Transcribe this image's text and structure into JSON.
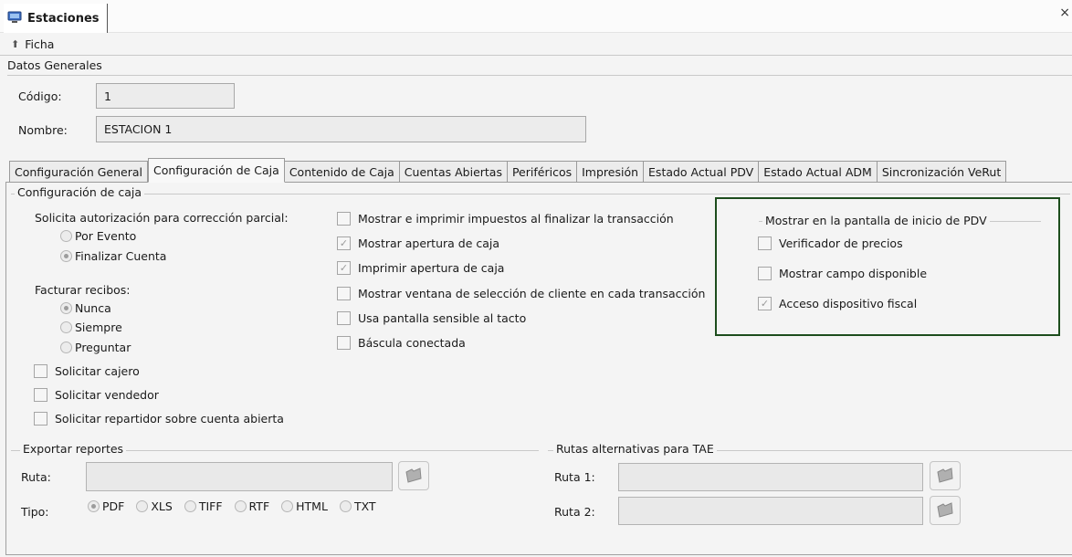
{
  "window": {
    "tab_title": "Estaciones",
    "close_glyph": "×",
    "icon": "monitor-icon"
  },
  "ficha": {
    "label": "Ficha",
    "icon": "double-chevron-up-icon"
  },
  "datos_generales": {
    "title": "Datos Generales",
    "codigo_label": "Código:",
    "codigo_value": "1",
    "nombre_label": "Nombre:",
    "nombre_value": "ESTACION 1"
  },
  "tabs": [
    {
      "label": "Configuración General",
      "active": false
    },
    {
      "label": "Configuración de Caja",
      "active": true
    },
    {
      "label": "Contenido de Caja",
      "active": false
    },
    {
      "label": "Cuentas Abiertas",
      "active": false
    },
    {
      "label": "Periféricos",
      "active": false
    },
    {
      "label": "Impresión",
      "active": false
    },
    {
      "label": "Estado Actual PDV",
      "active": false
    },
    {
      "label": "Estado Actual ADM",
      "active": false
    },
    {
      "label": "Sincronización VeRut",
      "active": false
    }
  ],
  "config_caja": {
    "title": "Configuración de caja",
    "autorizacion_label": "Solicita autorización para corrección parcial:",
    "autorizacion_options": [
      {
        "label": "Por Evento",
        "checked": false
      },
      {
        "label": "Finalizar Cuenta",
        "checked": true
      }
    ],
    "facturar_label": "Facturar recibos:",
    "facturar_options": [
      {
        "label": "Nunca",
        "checked": true
      },
      {
        "label": "Siempre",
        "checked": false
      },
      {
        "label": "Preguntar",
        "checked": false
      }
    ],
    "checks_left": [
      {
        "label": "Solicitar cajero",
        "checked": false
      },
      {
        "label": "Solicitar vendedor",
        "checked": false
      },
      {
        "label": "Solicitar repartidor sobre cuenta abierta",
        "checked": false
      }
    ],
    "checks_middle": [
      {
        "label": "Mostrar e imprimir impuestos al finalizar la transacción",
        "checked": false
      },
      {
        "label": "Mostrar apertura de caja",
        "checked": true
      },
      {
        "label": "Imprimir apertura de caja",
        "checked": true
      },
      {
        "label": "Mostrar ventana de selección de cliente en cada transacción",
        "checked": false
      },
      {
        "label": "Usa pantalla sensible al tacto",
        "checked": false
      },
      {
        "label": "Báscula conectada",
        "checked": false
      }
    ],
    "pdv_group": {
      "title": "Mostrar en la pantalla de inicio de PDV",
      "checks": [
        {
          "label": "Verificador de precios",
          "checked": false
        },
        {
          "label": "Mostrar campo disponible",
          "checked": false
        },
        {
          "label": "Acceso dispositivo fiscal",
          "checked": true
        }
      ]
    }
  },
  "exportar": {
    "title": "Exportar reportes",
    "ruta_label": "Ruta:",
    "ruta_value": "",
    "tipo_label": "Tipo:",
    "tipo_options": [
      {
        "label": "PDF",
        "checked": true
      },
      {
        "label": "XLS",
        "checked": false
      },
      {
        "label": "TIFF",
        "checked": false
      },
      {
        "label": "RTF",
        "checked": false
      },
      {
        "label": "HTML",
        "checked": false
      },
      {
        "label": "TXT",
        "checked": false
      }
    ]
  },
  "rutas_tae": {
    "title": "Rutas alternativas para TAE",
    "ruta1_label": "Ruta 1:",
    "ruta1_value": "",
    "ruta2_label": "Ruta 2:",
    "ruta2_value": ""
  },
  "colors": {
    "pdv_border": "#1d4d1d",
    "background": "#f4f4f4"
  }
}
